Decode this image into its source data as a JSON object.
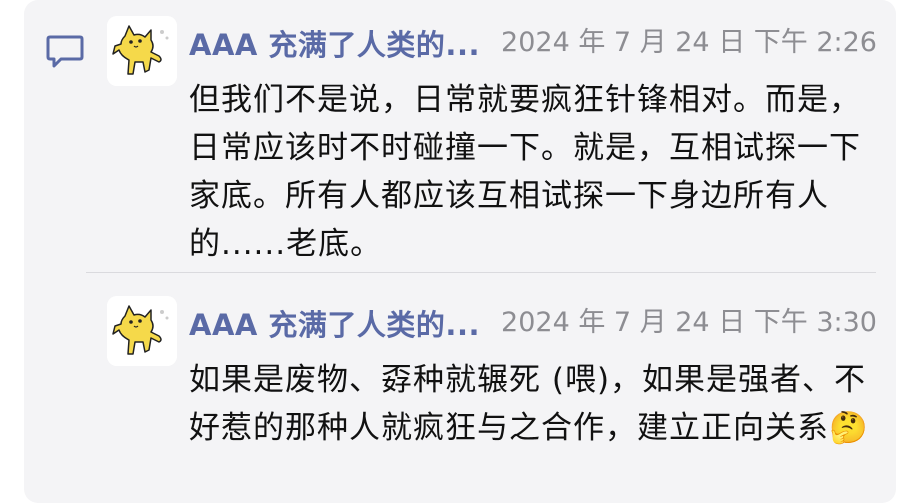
{
  "thread": {
    "posts": [
      {
        "username": "AAA 充满了人类的...",
        "timestamp": "2024 年 7 月 24 日 下午 2:26",
        "text": "但我们不是说，日常就要疯狂针锋相对。而是，日常应该时不时碰撞一下。就是，互相试探一下家底。所有人都应该互相试探一下身边所有人的......老底。",
        "avatar_icon": "yellow-cat-avatar-icon"
      },
      {
        "username": "AAA 充满了人类的...",
        "timestamp": "2024 年 7 月 24 日 下午 3:30",
        "text": "如果是废物、孬种就辗死 (喂)，如果是强者、不好惹的那种人就疯狂与之合作，建立正向关系🤔",
        "avatar_icon": "yellow-cat-avatar-icon"
      }
    ]
  },
  "colors": {
    "card_background": "#f4f4f6",
    "username": "#5a6aa6",
    "timestamp": "#8d8d92",
    "body_text": "#111111",
    "icon": "#5a6aa6",
    "avatar_cat": "#f5d94a"
  },
  "icons": {
    "comment": "comment-bubble-icon"
  }
}
